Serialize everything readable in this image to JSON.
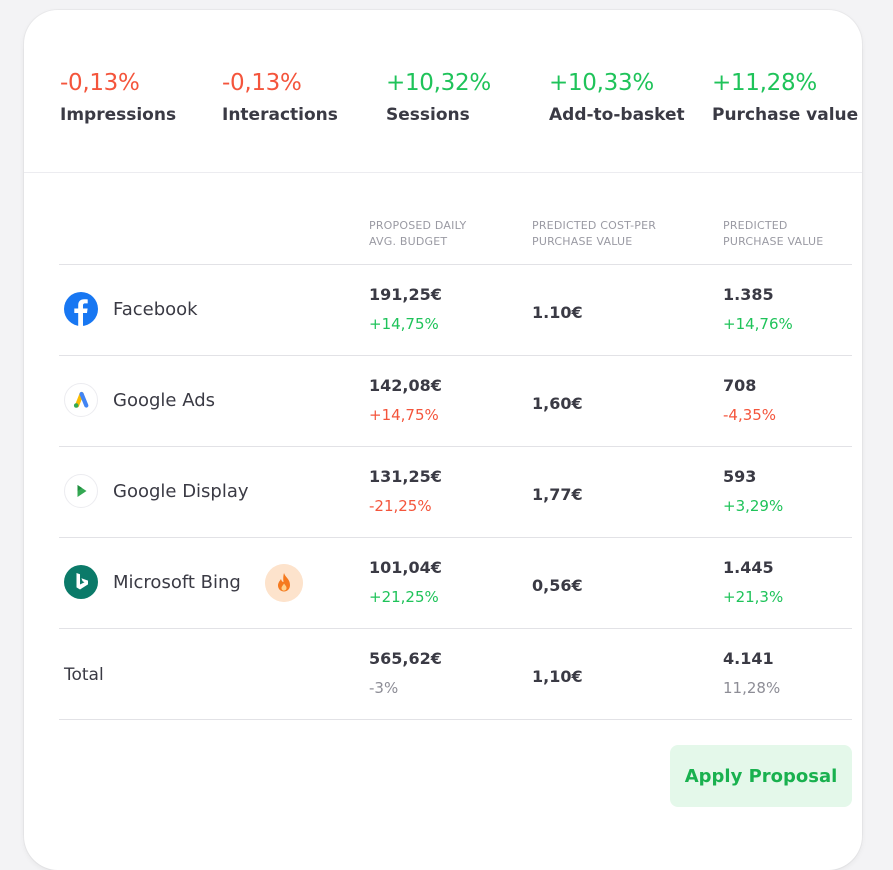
{
  "kpis": [
    {
      "value": "-0,13%",
      "label": "Impressions",
      "trend": "negative"
    },
    {
      "value": "-0,13%",
      "label": "Interactions",
      "trend": "negative"
    },
    {
      "value": "+10,32%",
      "label": "Sessions",
      "trend": "positive"
    },
    {
      "value": "+10,33%",
      "label": "Add-to-basket",
      "trend": "positive"
    },
    {
      "value": "+11,28%",
      "label": "Purchase value",
      "trend": "positive"
    }
  ],
  "table": {
    "headers": {
      "budget": [
        "PROPOSED DAILY",
        "AVG. BUDGET"
      ],
      "cpp": [
        "PREDICTED COST-PER",
        "PURCHASE VALUE"
      ],
      "pv": [
        "PREDICTED",
        "PURCHASE VALUE"
      ]
    },
    "rows": [
      {
        "channel": "Facebook",
        "icon": "facebook-icon",
        "budget": "191,25€",
        "budget_change": "+14,75%",
        "budget_trend": "positive",
        "cpp": "1.10€",
        "pv": "1.385",
        "pv_change": "+14,76%",
        "pv_trend": "positive"
      },
      {
        "channel": "Google Ads",
        "icon": "google-ads-icon",
        "budget": "142,08€",
        "budget_change": "+14,75%",
        "budget_trend": "negative",
        "cpp": "1,60€",
        "pv": "708",
        "pv_change": "-4,35%",
        "pv_trend": "negative"
      },
      {
        "channel": "Google Display",
        "icon": "google-display-icon",
        "budget": "131,25€",
        "budget_change": "-21,25%",
        "budget_trend": "negative",
        "cpp": "1,77€",
        "pv": "593",
        "pv_change": "+3,29%",
        "pv_trend": "positive"
      },
      {
        "channel": "Microsoft Bing",
        "icon": "microsoft-bing-icon",
        "badge_icon": "flame-icon",
        "budget": "101,04€",
        "budget_change": "+21,25%",
        "budget_trend": "positive",
        "cpp": "0,56€",
        "pv": "1.445",
        "pv_change": "+21,3%",
        "pv_trend": "positive"
      }
    ],
    "total": {
      "label": "Total",
      "budget": "565,62€",
      "budget_change": "-3%",
      "cpp": "1,10€",
      "pv": "4.141",
      "pv_change": "11,28%"
    }
  },
  "apply_button": "Apply Proposal",
  "colors": {
    "positive": "#1fc35a",
    "negative": "#f4553c",
    "neutral": "#8d8d96",
    "button_bg": "#e4f8ea"
  }
}
